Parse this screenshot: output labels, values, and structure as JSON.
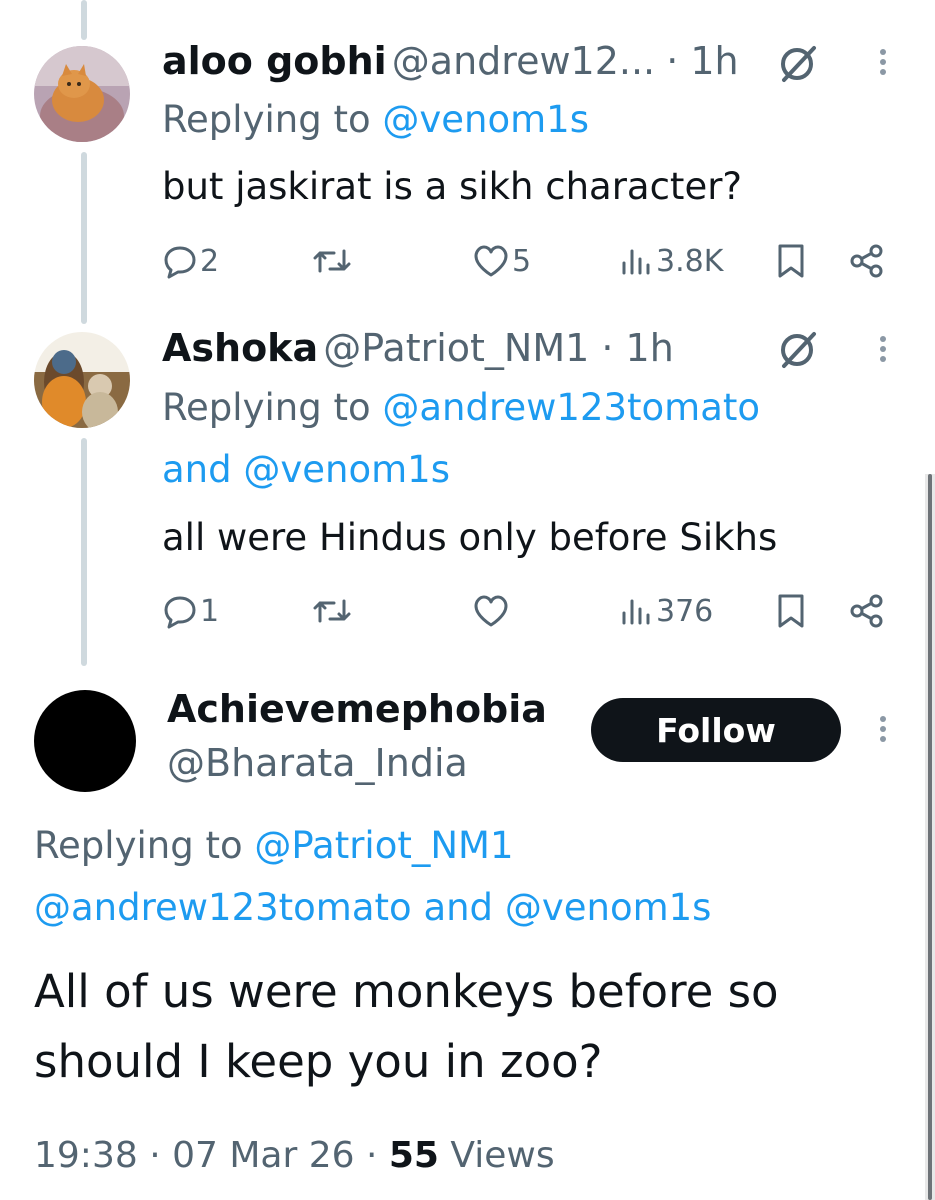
{
  "replies": [
    {
      "name": "aloo gobhi",
      "handle": "@andrew12...",
      "time": "· 1h",
      "replying_prefix": "Replying to",
      "replying_mentions_line1": "@venom1s",
      "text": "but jaskirat is a sikh character?",
      "replies_count": "2",
      "likes_count": "5",
      "views_count": "3.8K"
    },
    {
      "name": "Ashoka",
      "handle": "@Patriot_NM1 · 1h",
      "replying_prefix": "Replying to",
      "replying_mentions_line1": "@andrew123tomato",
      "replying_line2_and": "and",
      "replying_line2_mention": "@venom1s",
      "text": "all were Hindus only before Sikhs",
      "replies_count": "1",
      "likes_count": "",
      "views_count": "376"
    }
  ],
  "main": {
    "name": "Achievemephobia",
    "handle": "@Bharata_India",
    "follow_label": "Follow",
    "replying_prefix": "Replying to",
    "replying_mention1": "@Patriot_NM1",
    "replying_mention2": "@andrew123tomato",
    "replying_and": "and",
    "replying_mention3": "@venom1s",
    "text_line1": "All of us were monkeys before so",
    "text_line2": "should I keep you in zoo?",
    "time": "19:38 · 07 Mar 26 ·",
    "views_count": "55",
    "views_label": "Views"
  },
  "colors": {
    "accent": "#1d9bf0",
    "text": "#0f1419",
    "secondary": "#536471",
    "thread_line": "#cfd9de"
  },
  "icons": [
    "reply-icon",
    "retweet-icon",
    "like-icon",
    "views-icon",
    "bookmark-icon",
    "share-icon",
    "grok-icon",
    "more-icon"
  ]
}
